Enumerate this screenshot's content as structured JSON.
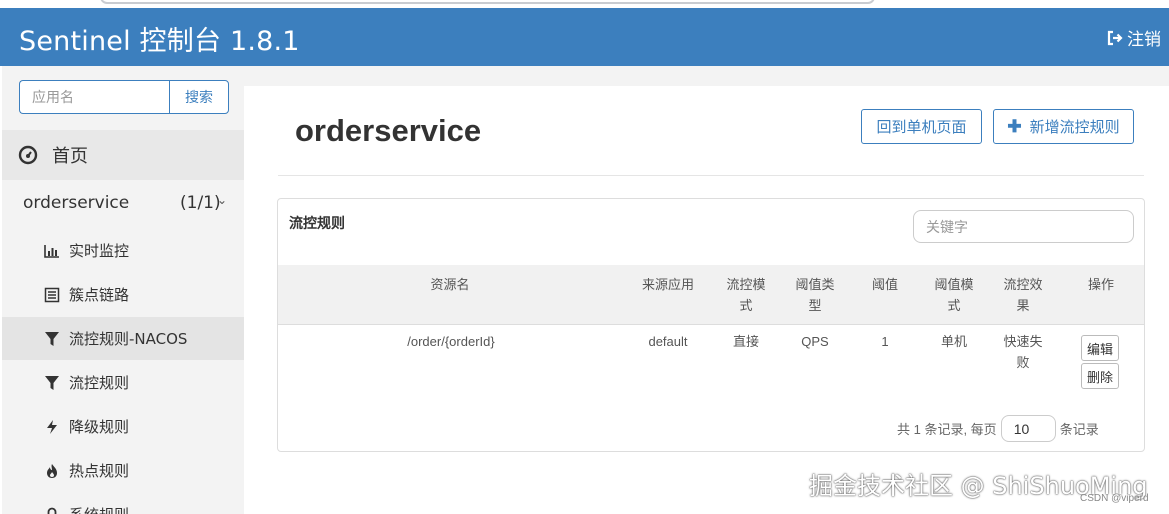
{
  "header": {
    "title": "Sentinel 控制台 1.8.1",
    "logout_label": "注销"
  },
  "sidebar": {
    "search_placeholder": "应用名",
    "search_button": "搜索",
    "home_label": "首页",
    "app": {
      "name": "orderservice",
      "count": "(1/1)"
    },
    "items": [
      {
        "label": "实时监控",
        "icon": "bar-chart-icon"
      },
      {
        "label": "簇点链路",
        "icon": "list-icon"
      },
      {
        "label": "流控规则-NACOS",
        "icon": "filter-icon",
        "active": true
      },
      {
        "label": "流控规则",
        "icon": "filter-icon"
      },
      {
        "label": "降级规则",
        "icon": "bolt-icon"
      },
      {
        "label": "热点规则",
        "icon": "fire-icon"
      },
      {
        "label": "系统规则",
        "icon": "lock-icon"
      }
    ]
  },
  "main": {
    "title": "orderservice",
    "back_button": "回到单机页面",
    "add_button": "新增流控规则",
    "panel_title": "流控规则",
    "keyword_placeholder": "关键字",
    "columns": {
      "resource": "资源名",
      "source": "来源应用",
      "mode_1": "流控模",
      "mode_2": "式",
      "threshold_type_1": "阈值类",
      "threshold_type_2": "型",
      "threshold": "阈值",
      "threshold_mode_1": "阈值模",
      "threshold_mode_2": "式",
      "effect_1": "流控效",
      "effect_2": "果",
      "actions": "操作"
    },
    "rows": [
      {
        "resource": "/order/{orderId}",
        "source": "default",
        "mode": "直接",
        "threshold_type": "QPS",
        "threshold": "1",
        "threshold_mode": "单机",
        "effect_1": "快速失",
        "effect_2": "败",
        "edit": "编辑",
        "delete": "删除"
      }
    ],
    "pager": {
      "prefix": "共 1 条记录, 每页",
      "page_size": "10",
      "suffix": "条记录"
    }
  },
  "watermark": "掘金技术社区 @ ShiShuoMing",
  "csdn_mark": "CSDN @viperd",
  "colors": {
    "header": "#3c7fbe",
    "accent": "#3c7fbe",
    "sidebar": "#f3f3f3"
  }
}
